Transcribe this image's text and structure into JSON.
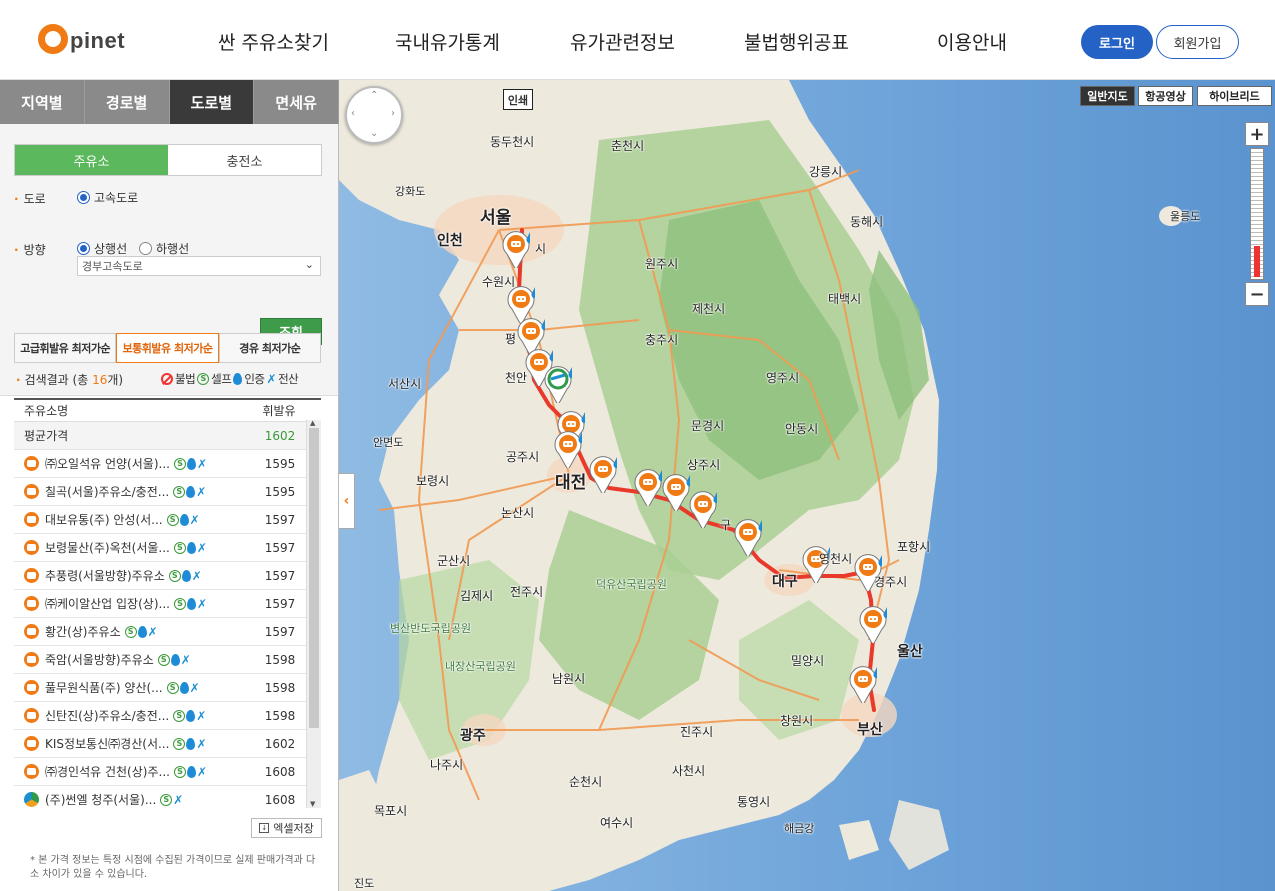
{
  "header": {
    "logo_letter": "O",
    "logo_text": "pinet",
    "nav": [
      "싼 주유소찾기",
      "국내유가통계",
      "유가관련정보",
      "불법행위공표",
      "이용안내"
    ],
    "login": "로그인",
    "join": "회원가입"
  },
  "left": {
    "tabs": [
      "지역별",
      "경로별",
      "도로별",
      "면세유"
    ],
    "active_tab": "도로별",
    "kind_tabs": [
      "주유소",
      "충전소"
    ],
    "road_label": "도로",
    "road_option": "고속도로",
    "road_select": "경부고속도로",
    "direction_label": "방향",
    "direction_options": [
      "상행선",
      "하행선"
    ],
    "search_button": "조회",
    "fuel_tabs": [
      "고급휘발유 최저가순",
      "보통휘발유 최저가순",
      "경유 최저가순"
    ],
    "result_prefix": "검색결과 (총 ",
    "result_count": "16",
    "result_suffix": "개)",
    "legend": {
      "illegal": "불법",
      "self": "셀프",
      "cert": "인증",
      "card": "전산"
    },
    "table": {
      "col_name": "주유소명",
      "col_price": "휘발유",
      "avg_label": "평균가격",
      "avg_price": "1602",
      "rows": [
        {
          "name": "㈜오일석유 언양(서울)...",
          "price": "1595",
          "icon": "orange"
        },
        {
          "name": "칠곡(서울)주유소/충전...",
          "price": "1595",
          "icon": "orange"
        },
        {
          "name": "대보유통(주) 안성(서...",
          "price": "1597",
          "icon": "orange"
        },
        {
          "name": "보령물산(주)옥천(서울...",
          "price": "1597",
          "icon": "orange"
        },
        {
          "name": "추풍령(서울방향)주유소",
          "price": "1597",
          "icon": "orange"
        },
        {
          "name": "㈜케이알산업 입장(상)...",
          "price": "1597",
          "icon": "orange"
        },
        {
          "name": "황간(상)주유소",
          "price": "1597",
          "icon": "orange"
        },
        {
          "name": "죽암(서울방향)주유소",
          "price": "1598",
          "icon": "orange"
        },
        {
          "name": "풀무원식품(주) 양산(...",
          "price": "1598",
          "icon": "orange"
        },
        {
          "name": "신탄진(상)주유소/충전...",
          "price": "1598",
          "icon": "orange"
        },
        {
          "name": "KIS정보통신㈜경산(서...",
          "price": "1602",
          "icon": "orange"
        },
        {
          "name": "㈜경인석유 건천(상)주...",
          "price": "1608",
          "icon": "orange"
        },
        {
          "name": "(주)썬엘 청주(서울)...",
          "price": "1608",
          "icon": "eco"
        }
      ]
    },
    "excel_button": "엑셀저장",
    "note": "* 본 가격 정보는 특정 시점에 수집된 가격이므로 실제 판매가격과 다소 차이가 있을 수 있습니다."
  },
  "map": {
    "print": "인쇄",
    "types": [
      "일반지도",
      "항공영상",
      "하이브리드"
    ],
    "active_type": "일반지도",
    "zoom_level": 0.24,
    "labels": {
      "seoul": "서울",
      "incheon": "인천",
      "suwon": "수원시",
      "pyeongtaek": "평",
      "cheonan": "천안",
      "daejeon": "대전",
      "daegu": "대구",
      "ulsan": "울산",
      "busan": "부산",
      "gwangju": "광주",
      "dongducheon": "동두천시",
      "chuncheon": "춘천시",
      "gangneung": "강릉시",
      "donghae": "동해시",
      "ganghwa": "강화도",
      "wonju": "원주시",
      "jecheon": "제천시",
      "chungju": "충주시",
      "taebaek": "태백시",
      "yeongju": "영주시",
      "andong": "안동시",
      "mungyeong": "문경시",
      "sangju": "상주시",
      "gongju": "공주시",
      "seosan": "서산시",
      "anmyeon": "안면도",
      "boryeong": "보령시",
      "nonsan": "논산시",
      "gunsan": "군산시",
      "gimje": "김제시",
      "jeonju": "전주시",
      "namwon": "남원시",
      "naju": "나주시",
      "mokpo": "목포시",
      "suncheon": "순천시",
      "jinju": "진주시",
      "sacheon": "사천시",
      "tongyeong": "통영시",
      "yeosu": "여수시",
      "changwon": "창원시",
      "miryang": "밀양시",
      "gyeongju": "경주시",
      "pohang": "포항시",
      "yeongcheon": "영천시",
      "ulleung": "울릉도",
      "deogyu": "덕유산국립공원",
      "byeonsan": "변산반도국립공원",
      "naejang": "내장산국립공원",
      "haegeum": "해금강",
      "jindo": "진도",
      "gumi": "구",
      "cheongju": "청주시",
      "gwangmyeong": "시"
    }
  },
  "colors": {
    "accent_orange": "#f07a13",
    "login_blue": "#2462c6",
    "search_green": "#3d9b4a",
    "kind_tab_green": "#5cb85c",
    "route_red": "#e8392a"
  }
}
